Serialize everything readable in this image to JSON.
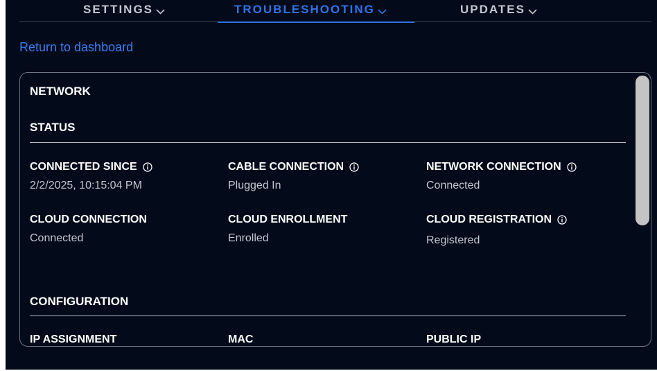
{
  "tabs": [
    {
      "label": "SETTINGS",
      "active": false
    },
    {
      "label": "TROUBLESHOOTING",
      "active": true
    },
    {
      "label": "UPDATES",
      "active": false
    }
  ],
  "return_link": "Return to dashboard",
  "card": {
    "title": "NETWORK",
    "status": {
      "heading": "STATUS",
      "fields": [
        {
          "label": "CONNECTED SINCE",
          "value": "2/2/2025, 10:15:04 PM",
          "info": true
        },
        {
          "label": "CABLE CONNECTION",
          "value": "Plugged In",
          "info": true
        },
        {
          "label": "NETWORK CONNECTION",
          "value": "Connected",
          "info": true
        },
        {
          "label": "CLOUD CONNECTION",
          "value": "Connected",
          "info": false
        },
        {
          "label": "CLOUD ENROLLMENT",
          "value": "Enrolled",
          "info": false
        },
        {
          "label": "CLOUD REGISTRATION",
          "value": "Registered",
          "info": true
        }
      ]
    },
    "configuration": {
      "heading": "CONFIGURATION",
      "fields": [
        {
          "label": "IP ASSIGNMENT"
        },
        {
          "label": "MAC"
        },
        {
          "label": "PUBLIC IP"
        }
      ]
    }
  },
  "colors": {
    "background": "#030a1a",
    "accent": "#2f73e8",
    "link": "#3a7ef0",
    "text_primary": "#ffffff",
    "text_secondary": "#c2c6cd"
  },
  "icons": {
    "tab_chevron": "chevron-down-icon",
    "info": "info-icon"
  }
}
